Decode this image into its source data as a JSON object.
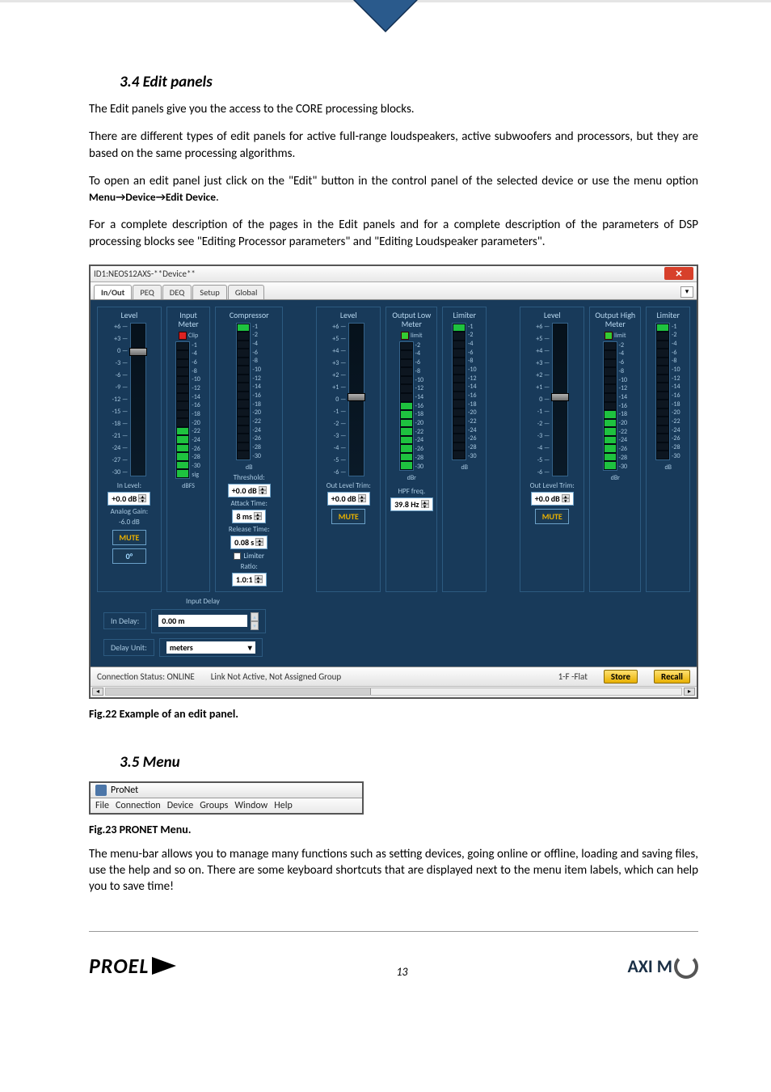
{
  "section34_title": "3.4   Edit panels",
  "p1": "The Edit panels give you the access to the CORE processing blocks.",
  "p2": "There are different types of edit panels for active full-range loudspeakers, active subwoofers and processors, but they are based on the same processing algorithms.",
  "p3a": "To open an edit panel just click on the \"Edit\" button in the control panel of the selected device or use the menu option ",
  "p3b": "Menu→Device→Edit Device",
  "p3c": ".",
  "p4": "For a complete description of the pages in the Edit panels and for a complete description of the parameters of DSP processing blocks see \"Editing Processor parameters\" and \"Editing Loudspeaker parameters\".",
  "editPanel": {
    "title": "ID1:NEOS12AXS-**Device**",
    "tabs": [
      "In/Out",
      "PEQ",
      "DEQ",
      "Setup",
      "Global"
    ],
    "cols": {
      "inputLevel": {
        "head": "Level",
        "ticks": [
          "+6 —",
          "+3 —",
          "0 —",
          "-3 —",
          "-6 —",
          "-9 —",
          "-12 —",
          "-15 —",
          "-18 —",
          "-21 —",
          "-24 —",
          "-27 —",
          "-30 —"
        ],
        "inLevelLabel": "In Level:",
        "inLevelVal": "+0.0 dB",
        "analogGainLabel": "Analog Gain:",
        "analogGainVal": "-6.0 dB",
        "mute": "MUTE",
        "phase": "0°"
      },
      "inputMeter": {
        "head": "Input\nMeter",
        "clip": "Clip",
        "ticks": [
          "-1",
          "-4",
          "-6",
          "-8",
          "-10",
          "-12",
          "-14",
          "-16",
          "-18",
          "-20",
          "-22",
          "-24",
          "-26",
          "-28",
          "-30",
          "sig"
        ],
        "unit": "dBFS"
      },
      "compressor": {
        "head": "Compressor",
        "ticks": [
          "-1",
          "-2",
          "-4",
          "-6",
          "-8",
          "-10",
          "-12",
          "-14",
          "-16",
          "-18",
          "-20",
          "-22",
          "-24",
          "-26",
          "-28",
          "-30"
        ],
        "unit": "dB",
        "thresholdLabel": "Threshold:",
        "thresholdVal": "+0.0 dB",
        "attackLabel": "Attack Time:",
        "attackVal": "8 ms",
        "releaseLabel": "Release Time:",
        "releaseVal": "0.08 s",
        "limiterLabel": "Limiter",
        "ratioLabel": "Ratio:",
        "ratioVal": "1.0:1"
      },
      "outLowLevel": {
        "head": "Level",
        "ticks": [
          "+6 —",
          "+5 —",
          "+4 —",
          "+3 —",
          "+2 —",
          "+1 —",
          "0 —",
          "-1 —",
          "-2 —",
          "-3 —",
          "-4 —",
          "-5 —",
          "-6 —"
        ],
        "outTrimLabel": "Out Level Trim:",
        "outTrimVal": "+0.0 dB",
        "mute": "MUTE"
      },
      "outLowMeter": {
        "head": "Output Low\nMeter",
        "limit": "limit",
        "ticks": [
          "-2",
          "-4",
          "-6",
          "-8",
          "-10",
          "-12",
          "-14",
          "-16",
          "-18",
          "-20",
          "-22",
          "-24",
          "-26",
          "-28",
          "-30"
        ],
        "unit": "dBr",
        "hpfLabel": "HPF freq.",
        "hpfVal": "39.8 Hz"
      },
      "limiterLow": {
        "head": "Limiter",
        "ticks": [
          "-1",
          "-2",
          "-4",
          "-6",
          "-8",
          "-10",
          "-12",
          "-14",
          "-16",
          "-18",
          "-20",
          "-22",
          "-24",
          "-26",
          "-28",
          "-30"
        ],
        "unit": "dB"
      },
      "outHighLevel": {
        "head": "Level",
        "ticks": [
          "+6 —",
          "+5 —",
          "+4 —",
          "+3 —",
          "+2 —",
          "+1 —",
          "0 —",
          "-1 —",
          "-2 —",
          "-3 —",
          "-4 —",
          "-5 —",
          "-6 —"
        ],
        "outTrimLabel": "Out Level Trim:",
        "outTrimVal": "+0.0 dB",
        "mute": "MUTE"
      },
      "outHighMeter": {
        "head": "Output High\nMeter",
        "limit": "limit",
        "ticks": [
          "-2",
          "-4",
          "-6",
          "-8",
          "-10",
          "-12",
          "-14",
          "-16",
          "-18",
          "-20",
          "-22",
          "-24",
          "-26",
          "-28",
          "-30"
        ],
        "unit": "dBr"
      },
      "limiterHigh": {
        "head": "Limiter",
        "ticks": [
          "-1",
          "-2",
          "-4",
          "-6",
          "-8",
          "-10",
          "-12",
          "-14",
          "-16",
          "-18",
          "-20",
          "-22",
          "-24",
          "-26",
          "-28",
          "-30"
        ],
        "unit": "dB"
      }
    },
    "delay": {
      "head": "Input Delay",
      "inDelayLabel": "In Delay:",
      "inDelayVal": "0.00 m",
      "unitLabel": "Delay Unit:",
      "unitVal": "meters"
    },
    "status": {
      "conn": "Connection Status: ONLINE",
      "link": "Link Not Active,  Not Assigned Group",
      "preset": "1-F -Flat",
      "store": "Store",
      "recall": "Recall"
    }
  },
  "fig22": "Fig.22 Example of an edit panel.",
  "section35_title": "3.5   Menu",
  "menuWindow": {
    "title": "ProNet",
    "items": [
      "File",
      "Connection",
      "Device",
      "Groups",
      "Window",
      "Help"
    ]
  },
  "fig23": "Fig.23 PRONET Menu.",
  "p5": "The menu-bar allows you to manage many functions such as setting devices, going online or offline, loading and saving files, use the help and so on. There are some keyboard shortcuts that are displayed next to the menu item labels, which can help you to save time!",
  "pageNumber": "13",
  "logoProel": "PROEL",
  "logoAxiom": "AXI   M"
}
